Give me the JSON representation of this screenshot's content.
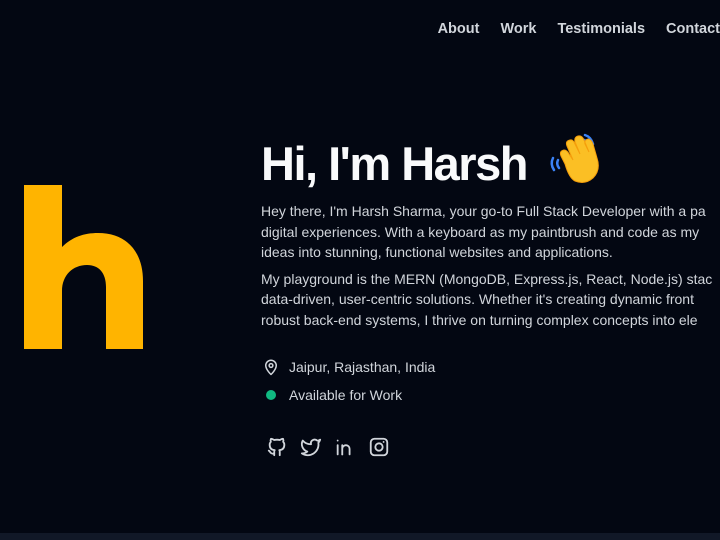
{
  "nav": {
    "items": [
      {
        "label": "About"
      },
      {
        "label": "Work"
      },
      {
        "label": "Testimonials"
      },
      {
        "label": "Contact"
      }
    ]
  },
  "logo": {
    "letter": "h",
    "color": "#ffb400"
  },
  "hero": {
    "title": "Hi, I'm Harsh",
    "wave_emoji": "waving-hand",
    "paragraph1": [
      "Hey there, I'm Harsh Sharma, your go-to Full Stack Developer with a pa",
      "digital experiences. With a keyboard as my paintbrush and code as my",
      "ideas into stunning, functional websites and applications."
    ],
    "paragraph2": [
      "My playground is the MERN (MongoDB, Express.js, React, Node.js) stac",
      "data-driven, user-centric solutions. Whether it's creating dynamic front",
      "robust back-end systems, I thrive on turning complex concepts into ele"
    ],
    "location": "Jaipur, Rajasthan, India",
    "availability": "Available for Work",
    "status_color": "#10b981"
  },
  "socials": [
    {
      "icon": "github-icon"
    },
    {
      "icon": "twitter-icon"
    },
    {
      "icon": "linkedin-icon"
    },
    {
      "icon": "instagram-icon"
    }
  ]
}
